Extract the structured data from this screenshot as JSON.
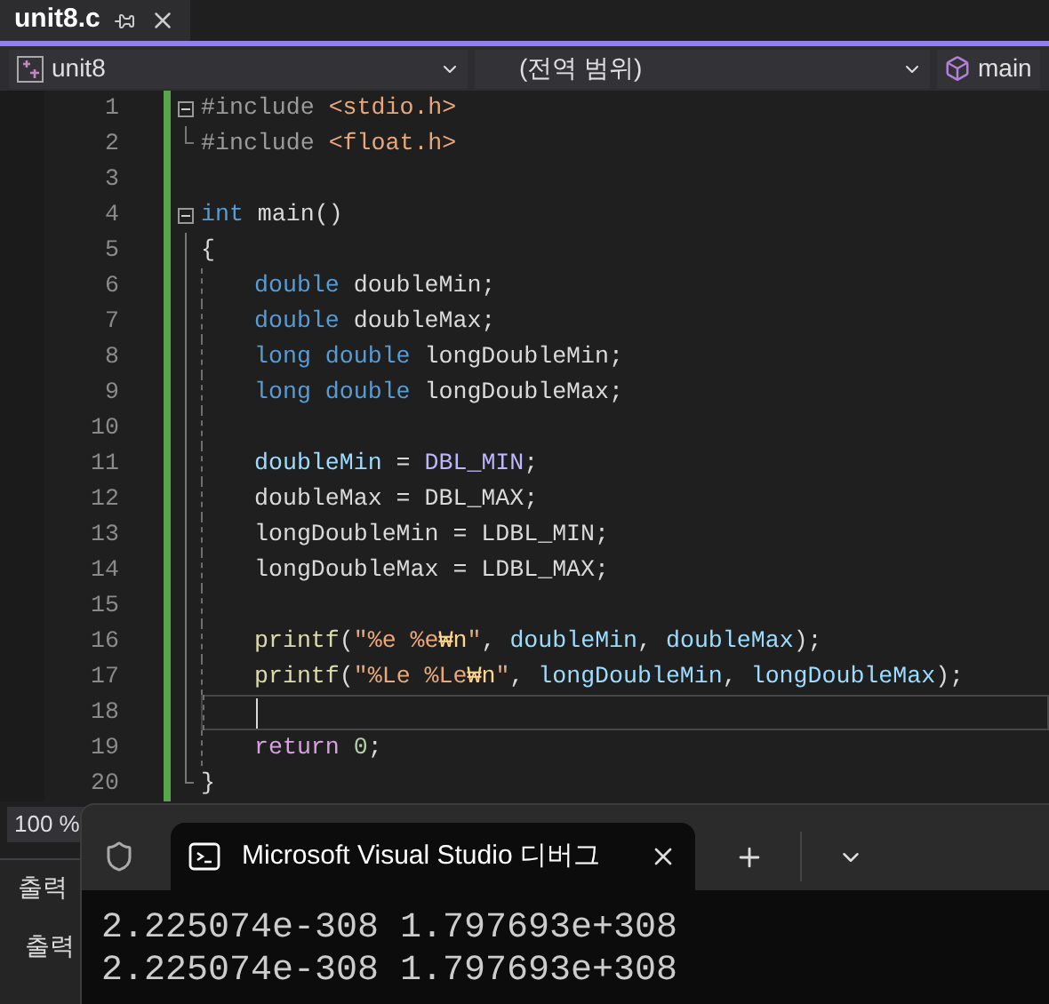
{
  "tabs": [
    {
      "label": "unit8.c",
      "selected": true
    }
  ],
  "navigation": {
    "project": "unit8",
    "scope": "(전역 범위)",
    "member": "main"
  },
  "code_lines": [
    {
      "number": "1",
      "kind": "fold-start",
      "current": false,
      "indented": false,
      "tokens": [
        {
          "kind": "preprocessor",
          "text": "#include "
        },
        {
          "kind": "include",
          "text": "<stdio.h>"
        }
      ]
    },
    {
      "number": "2",
      "kind": "fold-end",
      "current": false,
      "indented": false,
      "tokens": [
        {
          "kind": "preprocessor",
          "text": "#include "
        },
        {
          "kind": "include",
          "text": "<float.h>"
        }
      ]
    },
    {
      "number": "3",
      "kind": "plain",
      "current": false,
      "indented": false
    },
    {
      "number": "4",
      "kind": "fold-start",
      "current": false,
      "indented": false,
      "tokens": [
        {
          "kind": "keyword",
          "text": "int"
        },
        {
          "kind": "plain",
          "text": " main()"
        }
      ]
    },
    {
      "number": "5",
      "kind": "fold-middle",
      "current": false,
      "indented": false,
      "tokens": [
        {
          "kind": "plain",
          "text": "{"
        }
      ]
    },
    {
      "number": "6",
      "kind": "fold-middle",
      "current": false,
      "indented": true,
      "tokens": [
        {
          "kind": "keyword",
          "text": "double"
        },
        {
          "kind": "plain",
          "text": " doubleMin;"
        }
      ]
    },
    {
      "number": "7",
      "kind": "fold-middle",
      "current": false,
      "indented": true,
      "tokens": [
        {
          "kind": "keyword",
          "text": "double"
        },
        {
          "kind": "plain",
          "text": " doubleMax;"
        }
      ]
    },
    {
      "number": "8",
      "kind": "fold-middle",
      "current": false,
      "indented": true,
      "tokens": [
        {
          "kind": "keyword",
          "text": "long double"
        },
        {
          "kind": "plain",
          "text": " longDoubleMin;"
        }
      ]
    },
    {
      "number": "9",
      "kind": "fold-middle",
      "current": false,
      "indented": true,
      "tokens": [
        {
          "kind": "keyword",
          "text": "long double"
        },
        {
          "kind": "plain",
          "text": " longDoubleMax;"
        }
      ]
    },
    {
      "number": "10",
      "kind": "fold-middle",
      "current": false,
      "indented": true
    },
    {
      "number": "11",
      "kind": "fold-middle",
      "current": false,
      "indented": true,
      "tokens": [
        {
          "kind": "variable",
          "text": "doubleMin"
        },
        {
          "kind": "plain",
          "text": " = "
        },
        {
          "kind": "macro",
          "text": "DBL_MIN"
        },
        {
          "kind": "plain",
          "text": ";"
        }
      ]
    },
    {
      "number": "12",
      "kind": "fold-middle",
      "current": false,
      "indented": true,
      "tokens": [
        {
          "kind": "plain",
          "text": "doubleMax = DBL_MAX;"
        }
      ]
    },
    {
      "number": "13",
      "kind": "fold-middle",
      "current": false,
      "indented": true,
      "tokens": [
        {
          "kind": "plain",
          "text": "longDoubleMin = LDBL_MIN;"
        }
      ]
    },
    {
      "number": "14",
      "kind": "fold-middle",
      "current": false,
      "indented": true,
      "tokens": [
        {
          "kind": "plain",
          "text": "longDoubleMax = LDBL_MAX;"
        }
      ]
    },
    {
      "number": "15",
      "kind": "fold-middle",
      "current": false,
      "indented": true
    },
    {
      "number": "16",
      "kind": "fold-middle",
      "current": false,
      "indented": true,
      "tokens": [
        {
          "kind": "function",
          "text": "printf"
        },
        {
          "kind": "plain",
          "text": "("
        },
        {
          "kind": "string",
          "text": "\"%e %e"
        },
        {
          "kind": "escape",
          "text": "₩n"
        },
        {
          "kind": "string",
          "text": "\""
        },
        {
          "kind": "plain",
          "text": ", "
        },
        {
          "kind": "variable",
          "text": "doubleMin"
        },
        {
          "kind": "plain",
          "text": ", "
        },
        {
          "kind": "variable",
          "text": "doubleMax"
        },
        {
          "kind": "plain",
          "text": ");"
        }
      ]
    },
    {
      "number": "17",
      "kind": "fold-middle",
      "current": false,
      "indented": true,
      "tokens": [
        {
          "kind": "function",
          "text": "printf"
        },
        {
          "kind": "plain",
          "text": "("
        },
        {
          "kind": "string",
          "text": "\"%Le %Le"
        },
        {
          "kind": "escape",
          "text": "₩n"
        },
        {
          "kind": "string",
          "text": "\""
        },
        {
          "kind": "plain",
          "text": ", "
        },
        {
          "kind": "variable",
          "text": "longDoubleMin"
        },
        {
          "kind": "plain",
          "text": ", "
        },
        {
          "kind": "variable",
          "text": "longDoubleMax"
        },
        {
          "kind": "plain",
          "text": ");"
        }
      ]
    },
    {
      "number": "18",
      "kind": "fold-middle",
      "current": true,
      "indented": true
    },
    {
      "number": "19",
      "kind": "fold-middle",
      "current": false,
      "indented": true,
      "tokens": [
        {
          "kind": "control",
          "text": "return "
        },
        {
          "kind": "number",
          "text": "0"
        },
        {
          "kind": "plain",
          "text": ";"
        }
      ]
    },
    {
      "number": "20",
      "kind": "fold-end",
      "current": false,
      "indented": false,
      "tokens": [
        {
          "kind": "plain",
          "text": "}"
        }
      ]
    }
  ],
  "zoom": "100 %",
  "output_panel": {
    "tab": "출력",
    "label": "출력"
  },
  "terminal": {
    "tab_title": "Microsoft Visual Studio 디버그",
    "output": [
      "2.225074e-308 1.797693e+308",
      "2.225074e-308 1.797693e+308"
    ]
  }
}
